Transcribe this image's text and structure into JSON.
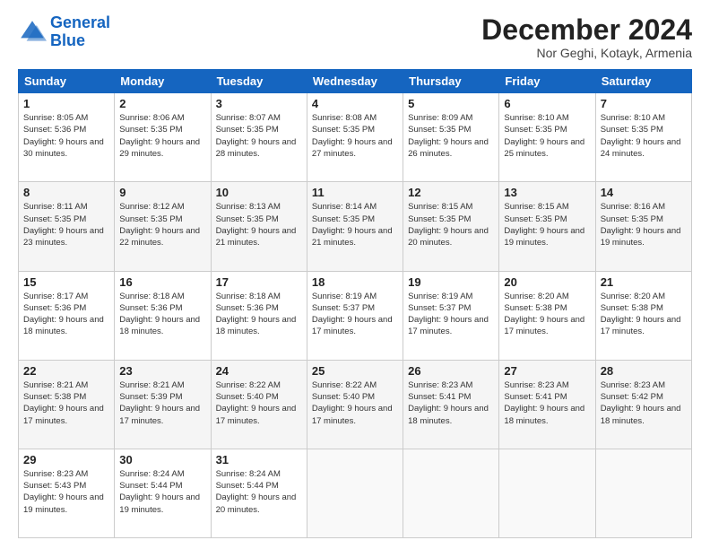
{
  "logo": {
    "line1": "General",
    "line2": "Blue"
  },
  "title": "December 2024",
  "subtitle": "Nor Geghi, Kotayk, Armenia",
  "days_header": [
    "Sunday",
    "Monday",
    "Tuesday",
    "Wednesday",
    "Thursday",
    "Friday",
    "Saturday"
  ],
  "weeks": [
    [
      {
        "day": "1",
        "sunrise": "Sunrise: 8:05 AM",
        "sunset": "Sunset: 5:36 PM",
        "daylight": "Daylight: 9 hours and 30 minutes."
      },
      {
        "day": "2",
        "sunrise": "Sunrise: 8:06 AM",
        "sunset": "Sunset: 5:35 PM",
        "daylight": "Daylight: 9 hours and 29 minutes."
      },
      {
        "day": "3",
        "sunrise": "Sunrise: 8:07 AM",
        "sunset": "Sunset: 5:35 PM",
        "daylight": "Daylight: 9 hours and 28 minutes."
      },
      {
        "day": "4",
        "sunrise": "Sunrise: 8:08 AM",
        "sunset": "Sunset: 5:35 PM",
        "daylight": "Daylight: 9 hours and 27 minutes."
      },
      {
        "day": "5",
        "sunrise": "Sunrise: 8:09 AM",
        "sunset": "Sunset: 5:35 PM",
        "daylight": "Daylight: 9 hours and 26 minutes."
      },
      {
        "day": "6",
        "sunrise": "Sunrise: 8:10 AM",
        "sunset": "Sunset: 5:35 PM",
        "daylight": "Daylight: 9 hours and 25 minutes."
      },
      {
        "day": "7",
        "sunrise": "Sunrise: 8:10 AM",
        "sunset": "Sunset: 5:35 PM",
        "daylight": "Daylight: 9 hours and 24 minutes."
      }
    ],
    [
      {
        "day": "8",
        "sunrise": "Sunrise: 8:11 AM",
        "sunset": "Sunset: 5:35 PM",
        "daylight": "Daylight: 9 hours and 23 minutes."
      },
      {
        "day": "9",
        "sunrise": "Sunrise: 8:12 AM",
        "sunset": "Sunset: 5:35 PM",
        "daylight": "Daylight: 9 hours and 22 minutes."
      },
      {
        "day": "10",
        "sunrise": "Sunrise: 8:13 AM",
        "sunset": "Sunset: 5:35 PM",
        "daylight": "Daylight: 9 hours and 21 minutes."
      },
      {
        "day": "11",
        "sunrise": "Sunrise: 8:14 AM",
        "sunset": "Sunset: 5:35 PM",
        "daylight": "Daylight: 9 hours and 21 minutes."
      },
      {
        "day": "12",
        "sunrise": "Sunrise: 8:15 AM",
        "sunset": "Sunset: 5:35 PM",
        "daylight": "Daylight: 9 hours and 20 minutes."
      },
      {
        "day": "13",
        "sunrise": "Sunrise: 8:15 AM",
        "sunset": "Sunset: 5:35 PM",
        "daylight": "Daylight: 9 hours and 19 minutes."
      },
      {
        "day": "14",
        "sunrise": "Sunrise: 8:16 AM",
        "sunset": "Sunset: 5:35 PM",
        "daylight": "Daylight: 9 hours and 19 minutes."
      }
    ],
    [
      {
        "day": "15",
        "sunrise": "Sunrise: 8:17 AM",
        "sunset": "Sunset: 5:36 PM",
        "daylight": "Daylight: 9 hours and 18 minutes."
      },
      {
        "day": "16",
        "sunrise": "Sunrise: 8:18 AM",
        "sunset": "Sunset: 5:36 PM",
        "daylight": "Daylight: 9 hours and 18 minutes."
      },
      {
        "day": "17",
        "sunrise": "Sunrise: 8:18 AM",
        "sunset": "Sunset: 5:36 PM",
        "daylight": "Daylight: 9 hours and 18 minutes."
      },
      {
        "day": "18",
        "sunrise": "Sunrise: 8:19 AM",
        "sunset": "Sunset: 5:37 PM",
        "daylight": "Daylight: 9 hours and 17 minutes."
      },
      {
        "day": "19",
        "sunrise": "Sunrise: 8:19 AM",
        "sunset": "Sunset: 5:37 PM",
        "daylight": "Daylight: 9 hours and 17 minutes."
      },
      {
        "day": "20",
        "sunrise": "Sunrise: 8:20 AM",
        "sunset": "Sunset: 5:38 PM",
        "daylight": "Daylight: 9 hours and 17 minutes."
      },
      {
        "day": "21",
        "sunrise": "Sunrise: 8:20 AM",
        "sunset": "Sunset: 5:38 PM",
        "daylight": "Daylight: 9 hours and 17 minutes."
      }
    ],
    [
      {
        "day": "22",
        "sunrise": "Sunrise: 8:21 AM",
        "sunset": "Sunset: 5:38 PM",
        "daylight": "Daylight: 9 hours and 17 minutes."
      },
      {
        "day": "23",
        "sunrise": "Sunrise: 8:21 AM",
        "sunset": "Sunset: 5:39 PM",
        "daylight": "Daylight: 9 hours and 17 minutes."
      },
      {
        "day": "24",
        "sunrise": "Sunrise: 8:22 AM",
        "sunset": "Sunset: 5:40 PM",
        "daylight": "Daylight: 9 hours and 17 minutes."
      },
      {
        "day": "25",
        "sunrise": "Sunrise: 8:22 AM",
        "sunset": "Sunset: 5:40 PM",
        "daylight": "Daylight: 9 hours and 17 minutes."
      },
      {
        "day": "26",
        "sunrise": "Sunrise: 8:23 AM",
        "sunset": "Sunset: 5:41 PM",
        "daylight": "Daylight: 9 hours and 18 minutes."
      },
      {
        "day": "27",
        "sunrise": "Sunrise: 8:23 AM",
        "sunset": "Sunset: 5:41 PM",
        "daylight": "Daylight: 9 hours and 18 minutes."
      },
      {
        "day": "28",
        "sunrise": "Sunrise: 8:23 AM",
        "sunset": "Sunset: 5:42 PM",
        "daylight": "Daylight: 9 hours and 18 minutes."
      }
    ],
    [
      {
        "day": "29",
        "sunrise": "Sunrise: 8:23 AM",
        "sunset": "Sunset: 5:43 PM",
        "daylight": "Daylight: 9 hours and 19 minutes."
      },
      {
        "day": "30",
        "sunrise": "Sunrise: 8:24 AM",
        "sunset": "Sunset: 5:44 PM",
        "daylight": "Daylight: 9 hours and 19 minutes."
      },
      {
        "day": "31",
        "sunrise": "Sunrise: 8:24 AM",
        "sunset": "Sunset: 5:44 PM",
        "daylight": "Daylight: 9 hours and 20 minutes."
      },
      null,
      null,
      null,
      null
    ]
  ]
}
